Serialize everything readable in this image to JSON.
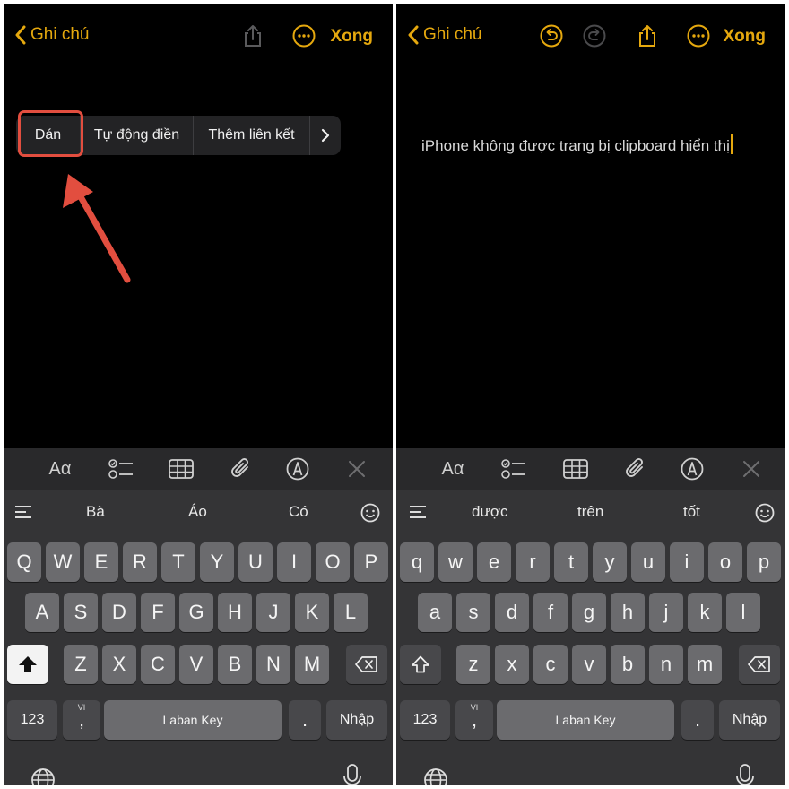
{
  "left": {
    "nav": {
      "back_label": "Ghi chú",
      "done_label": "Xong"
    },
    "context_menu": {
      "items": [
        "Dán",
        "Tự động điền",
        "Thêm liên kết"
      ]
    },
    "suggestions": [
      "Bà",
      "Áo",
      "Có"
    ],
    "keys": {
      "row1": [
        "Q",
        "W",
        "E",
        "R",
        "T",
        "Y",
        "U",
        "I",
        "O",
        "P"
      ],
      "row2": [
        "A",
        "S",
        "D",
        "F",
        "G",
        "H",
        "J",
        "K",
        "L"
      ],
      "row3": [
        "Z",
        "X",
        "C",
        "V",
        "B",
        "N",
        "M"
      ]
    },
    "bottom": {
      "numbers": "123",
      "comma": ",",
      "comma_tag": "VI",
      "space": "Laban Key",
      "period": ".",
      "return": "Nhập"
    }
  },
  "right": {
    "nav": {
      "back_label": "Ghi chú",
      "done_label": "Xong"
    },
    "note_text": "iPhone không được trang bị clipboard hiển thị",
    "suggestions": [
      "được",
      "trên",
      "tốt"
    ],
    "keys": {
      "row1": [
        "q",
        "w",
        "e",
        "r",
        "t",
        "y",
        "u",
        "i",
        "o",
        "p"
      ],
      "row2": [
        "a",
        "s",
        "d",
        "f",
        "g",
        "h",
        "j",
        "k",
        "l"
      ],
      "row3": [
        "z",
        "x",
        "c",
        "v",
        "b",
        "n",
        "m"
      ]
    },
    "bottom": {
      "numbers": "123",
      "comma": ",",
      "comma_tag": "VI",
      "space": "Laban Key",
      "period": ".",
      "return": "Nhập"
    }
  },
  "format_bar": {
    "text_style": "Aα"
  },
  "colors": {
    "accent": "#e5a80e",
    "highlight": "#e24e3f",
    "background": "#000000",
    "keyboard": "#343436",
    "key": "#6b6b6e"
  }
}
